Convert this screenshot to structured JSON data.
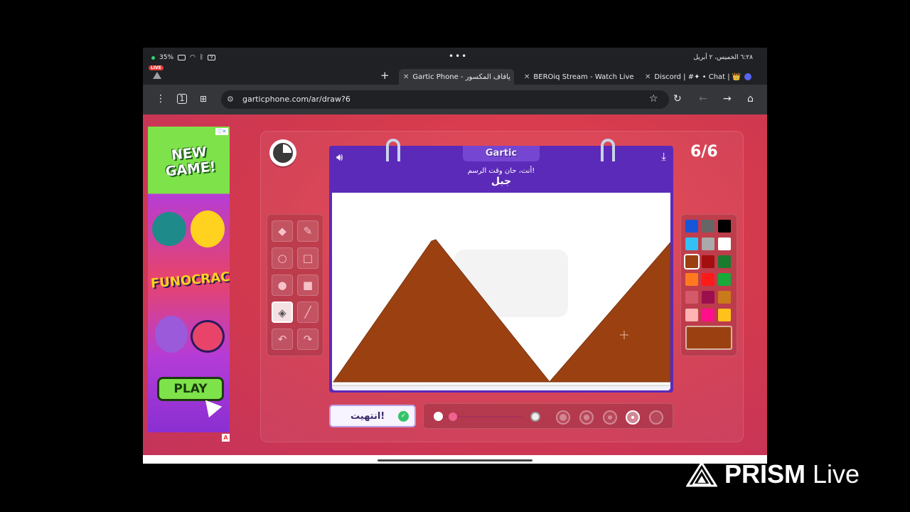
{
  "status_bar": {
    "battery": "35%",
    "right_text": "٦:٢٨  الخميس، ٢ أبريل"
  },
  "tabs": {
    "live_badge": "LIVE",
    "items": [
      {
        "label": "Gartic Phone - يافاف المكسور"
      },
      {
        "label": "BEROiq Stream - Watch Live"
      },
      {
        "label": "Discord | #✦ • Chat | 👑"
      }
    ]
  },
  "address_bar": {
    "url": "garticphone.com/ar/draw?6"
  },
  "ad": {
    "headline": "NEW GAME!",
    "brand": "FUNOCRACY",
    "cta": "PLAY",
    "corner_label": "A"
  },
  "game": {
    "round": "6/6",
    "logo": "Gartic",
    "prompt_line": "أنت، حان وقت الرسم!",
    "word": "جبل",
    "done_label": "انتهيت!",
    "selected_color": "#9B4111",
    "palette": [
      "#1856d8",
      "#666666",
      "#000000",
      "#33c1f5",
      "#aaaaaa",
      "#ffffff",
      "#9B4111",
      "#a30e0e",
      "#1a7a2e",
      "#ff7a1f",
      "#ff1a1a",
      "#19a83a",
      "#d45a6a",
      "#9b0f4f",
      "#c97a1a",
      "#ffb3b3",
      "#ff0f8a",
      "#ffc21a"
    ],
    "tools": [
      "eraser-icon",
      "pencil-icon",
      "circle-outline-icon",
      "square-outline-icon",
      "circle-fill-icon",
      "square-fill-icon",
      "fill-bucket-icon",
      "line-icon",
      "undo-icon",
      "redo-icon"
    ],
    "selected_tool": "fill-bucket-icon"
  },
  "watermark": {
    "brand_bold": "PRISM",
    "brand_light": "Live"
  }
}
